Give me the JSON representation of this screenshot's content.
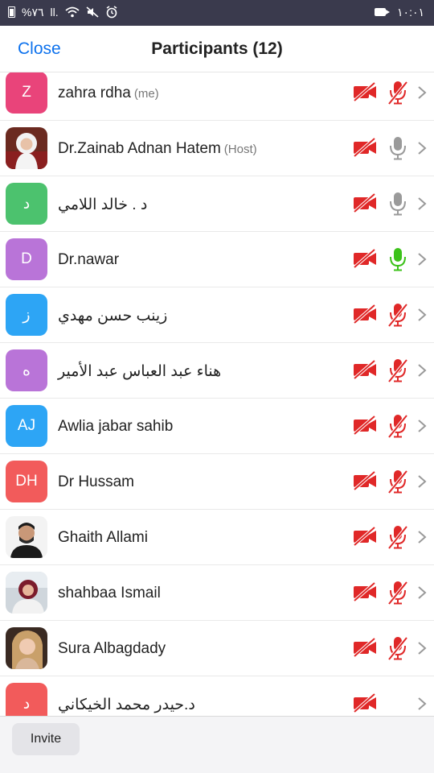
{
  "status_bar": {
    "battery_text": "%٧٦",
    "signal_text": "ll.",
    "time": "١٠:٠١",
    "icons": [
      "battery-icon",
      "signal-icon",
      "wifi-icon",
      "mute-icon",
      "alarm-icon",
      "video-recording-icon"
    ]
  },
  "header": {
    "close_label": "Close",
    "title": "Participants (12)"
  },
  "colors": {
    "accent_blue": "#0e72ed",
    "muted_red": "#e02828",
    "active_green": "#3cc21a",
    "mic_gray": "#9a9a9a",
    "avatar_pink": "#e9447a",
    "avatar_green": "#4cc26e",
    "avatar_purple": "#b974d8",
    "avatar_blue": "#2da5f5",
    "avatar_red": "#f25b5b"
  },
  "participants": [
    {
      "name": "zahra rdha",
      "tag": "(me)",
      "initials": "Z",
      "avatar_color": "#e9447a",
      "video": "off",
      "mic": "muted"
    },
    {
      "name": "Dr.Zainab Adnan Hatem",
      "tag": "(Host)",
      "initials": "",
      "avatar_color": "photo",
      "video": "off",
      "mic": "unmuted"
    },
    {
      "name": "د . خالد اللامي",
      "tag": "",
      "initials": "د",
      "avatar_color": "#4cc26e",
      "video": "off",
      "mic": "unmuted"
    },
    {
      "name": "Dr.nawar",
      "tag": "",
      "initials": "D",
      "avatar_color": "#b974d8",
      "video": "off",
      "mic": "speaking"
    },
    {
      "name": "زينب حسن مهدي",
      "tag": "",
      "initials": "ز",
      "avatar_color": "#2da5f5",
      "video": "off",
      "mic": "muted"
    },
    {
      "name": "هناء عبد العباس عبد الأمير",
      "tag": "",
      "initials": "ه",
      "avatar_color": "#b974d8",
      "video": "off",
      "mic": "muted"
    },
    {
      "name": "Awlia jabar sahib",
      "tag": "",
      "initials": "AJ",
      "avatar_color": "#2da5f5",
      "video": "off",
      "mic": "muted"
    },
    {
      "name": "Dr Hussam",
      "tag": "",
      "initials": "DH",
      "avatar_color": "#f25b5b",
      "video": "off",
      "mic": "muted"
    },
    {
      "name": "Ghaith Allami",
      "tag": "",
      "initials": "",
      "avatar_color": "photo",
      "video": "off",
      "mic": "muted"
    },
    {
      "name": "shahbaa Ismail",
      "tag": "",
      "initials": "",
      "avatar_color": "photo",
      "video": "off",
      "mic": "muted"
    },
    {
      "name": "Sura Albagdady",
      "tag": "",
      "initials": "",
      "avatar_color": "photo",
      "video": "off",
      "mic": "muted"
    },
    {
      "name": "د.حيدر محمد الخيكاني",
      "tag": "",
      "initials": "د",
      "avatar_color": "#f25b5b",
      "video": "off",
      "mic": "none"
    }
  ],
  "footer": {
    "invite_label": "Invite"
  }
}
